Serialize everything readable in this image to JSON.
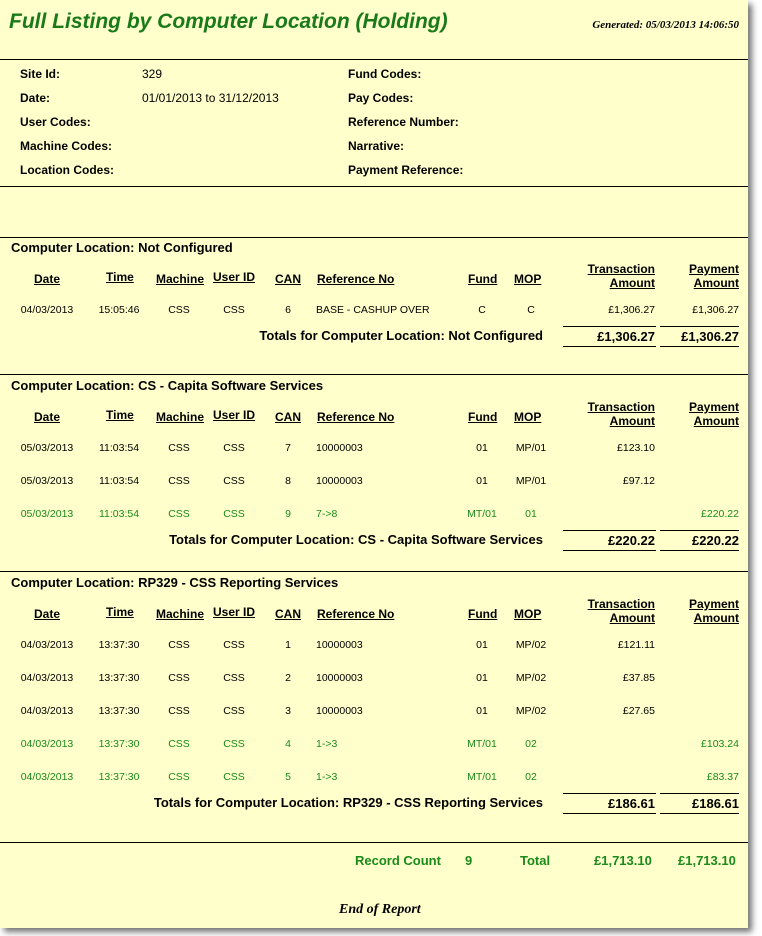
{
  "report": {
    "title": "Full Listing by Computer Location (Holding)",
    "generated": "Generated: 05/03/2013 14:06:50",
    "end_text": "End of Report"
  },
  "criteria": {
    "left": [
      {
        "label": "Site Id:",
        "value": "329"
      },
      {
        "label": "Date:",
        "value": "01/01/2013 to 31/12/2013"
      },
      {
        "label": "User Codes:",
        "value": ""
      },
      {
        "label": "Machine Codes:",
        "value": ""
      },
      {
        "label": "Location Codes:",
        "value": ""
      }
    ],
    "right": [
      {
        "label": "Fund Codes:",
        "value": ""
      },
      {
        "label": "Pay Codes:",
        "value": ""
      },
      {
        "label": "Reference Number:",
        "value": ""
      },
      {
        "label": "Narrative:",
        "value": ""
      },
      {
        "label": "Payment Reference:",
        "value": ""
      }
    ]
  },
  "columns": {
    "date": "Date",
    "time": "Time",
    "machine": "Machine",
    "user_id": "User ID",
    "can": "CAN",
    "reference_no": "Reference No",
    "fund": "Fund",
    "mop": "MOP",
    "transaction_amount_1": "Transaction",
    "transaction_amount_2": "Amount",
    "payment_amount_1": "Payment",
    "payment_amount_2": "Amount"
  },
  "colors": {
    "background": "#ffffcc",
    "title_green": "#1a7a1a",
    "highlight_green": "#1a8a1a"
  },
  "sections": [
    {
      "title": "Computer Location: Not Configured",
      "rows": [
        {
          "date": "04/03/2013",
          "time": "15:05:46",
          "machine": "CSS",
          "user_id": "CSS",
          "can": "6",
          "reference_no": "BASE - CASHUP OVER",
          "fund": "C",
          "mop": "C",
          "transaction_amount": "£1,306.27",
          "payment_amount": "£1,306.27",
          "highlight": false
        }
      ],
      "totals_label": "Totals for Computer Location: Not Configured",
      "total_transaction": "£1,306.27",
      "total_payment": "£1,306.27"
    },
    {
      "title": "Computer Location: CS - Capita Software Services",
      "rows": [
        {
          "date": "05/03/2013",
          "time": "11:03:54",
          "machine": "CSS",
          "user_id": "CSS",
          "can": "7",
          "reference_no": "10000003",
          "fund": "01",
          "mop": "MP/01",
          "transaction_amount": "£123.10",
          "payment_amount": "",
          "highlight": false
        },
        {
          "date": "05/03/2013",
          "time": "11:03:54",
          "machine": "CSS",
          "user_id": "CSS",
          "can": "8",
          "reference_no": "10000003",
          "fund": "01",
          "mop": "MP/01",
          "transaction_amount": "£97.12",
          "payment_amount": "",
          "highlight": false
        },
        {
          "date": "05/03/2013",
          "time": "11:03:54",
          "machine": "CSS",
          "user_id": "CSS",
          "can": "9",
          "reference_no": "7->8",
          "fund": "MT/01",
          "mop": "01",
          "transaction_amount": "",
          "payment_amount": "£220.22",
          "highlight": true
        }
      ],
      "totals_label": "Totals for Computer Location: CS - Capita Software Services",
      "total_transaction": "£220.22",
      "total_payment": "£220.22"
    },
    {
      "title": "Computer Location: RP329 - CSS Reporting Services",
      "rows": [
        {
          "date": "04/03/2013",
          "time": "13:37:30",
          "machine": "CSS",
          "user_id": "CSS",
          "can": "1",
          "reference_no": "10000003",
          "fund": "01",
          "mop": "MP/02",
          "transaction_amount": "£121.11",
          "payment_amount": "",
          "highlight": false
        },
        {
          "date": "04/03/2013",
          "time": "13:37:30",
          "machine": "CSS",
          "user_id": "CSS",
          "can": "2",
          "reference_no": "10000003",
          "fund": "01",
          "mop": "MP/02",
          "transaction_amount": "£37.85",
          "payment_amount": "",
          "highlight": false
        },
        {
          "date": "04/03/2013",
          "time": "13:37:30",
          "machine": "CSS",
          "user_id": "CSS",
          "can": "3",
          "reference_no": "10000003",
          "fund": "01",
          "mop": "MP/02",
          "transaction_amount": "£27.65",
          "payment_amount": "",
          "highlight": false
        },
        {
          "date": "04/03/2013",
          "time": "13:37:30",
          "machine": "CSS",
          "user_id": "CSS",
          "can": "4",
          "reference_no": "1->3",
          "fund": "MT/01",
          "mop": "02",
          "transaction_amount": "",
          "payment_amount": "£103.24",
          "highlight": true
        },
        {
          "date": "04/03/2013",
          "time": "13:37:30",
          "machine": "CSS",
          "user_id": "CSS",
          "can": "5",
          "reference_no": "1->3",
          "fund": "MT/01",
          "mop": "02",
          "transaction_amount": "",
          "payment_amount": "£83.37",
          "highlight": true
        }
      ],
      "totals_label": "Totals for Computer Location: RP329 - CSS Reporting Services",
      "total_transaction": "£186.61",
      "total_payment": "£186.61"
    }
  ],
  "grand_total": {
    "record_count_label": "Record Count",
    "record_count": "9",
    "total_label": "Total",
    "total_transaction": "£1,713.10",
    "total_payment": "£1,713.10"
  }
}
